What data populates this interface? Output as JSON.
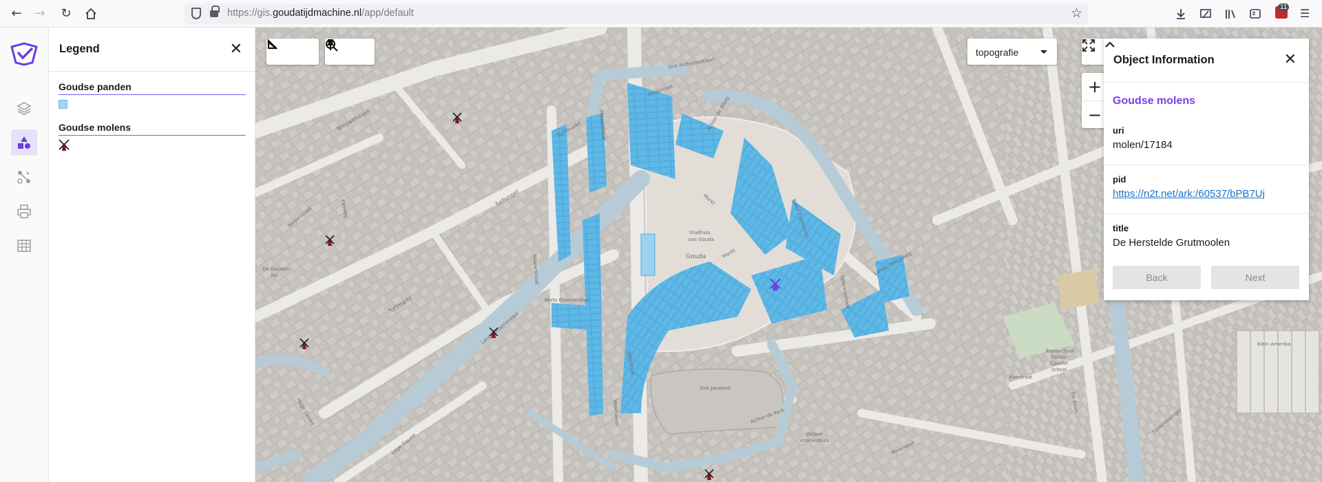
{
  "browser": {
    "url_prefix": "https://gis.",
    "url_domain": "goudatijdmachine.nl",
    "url_path": "/app/default",
    "extension_count": "11"
  },
  "rail": {
    "items": [
      {
        "name": "layers-icon",
        "active": false
      },
      {
        "name": "legend-icon",
        "active": true
      },
      {
        "name": "analysis-icon",
        "active": false
      },
      {
        "name": "print-icon",
        "active": false
      },
      {
        "name": "table-icon",
        "active": false
      }
    ]
  },
  "legend": {
    "title": "Legend",
    "layers": [
      {
        "name": "Goudse panden",
        "symbol": "blue-square",
        "color": "#9fd6f3"
      },
      {
        "name": "Goudse molens",
        "symbol": "windmill-icon"
      }
    ]
  },
  "map": {
    "basemap": "topografie",
    "colors": {
      "panden_fill": "#5fb8e6",
      "water": "#b7cbd6",
      "buildings": "#cbc8c4",
      "ground": "#e7e3dc"
    },
    "labels": {
      "turfmarkt": "Turfmarkt",
      "turfsingel": "Turfsingel",
      "nieuwehaven": "Nieuwehaven",
      "hoogstraat": "Hoogstraat",
      "markt_1": "Markt",
      "markt_2": "Markt",
      "stadhuis_1": "Stadhuis",
      "stadhuis_2": "van Gouda",
      "gouda": "Gouda",
      "sint_janskerk": "Sint-Janskerk",
      "korte_groenendaal": "Korte Groenendaal",
      "lange_groenendaal": "Lange Groenendaal",
      "lange_tiendeweg": "Lange Tiendeweg",
      "zeugstraat": "Zeugstraat",
      "westhaven": "Westhaven",
      "achter_de_kerk": "Achter de Kerk",
      "klein_amerika": "Klein Amerika",
      "basisschool_1": "Basisschool",
      "basisschool_2": "Dalton",
      "basisschool_3": "Casimir",
      "basisschool_4": "school",
      "de_gouden_aar_1": "De Gouden",
      "de_gouden_aar_2": "Aar",
      "naaierstraat": "Naaierstraat",
      "keizerstraat": "Keizerstraat",
      "willem_1": "Willem",
      "willem_2": "Vroesenhuis",
      "kleiwegstraat": "Kleiweg",
      "wijdstraat": "Wijdstraat",
      "kerksteeg": "Kerksteeg",
      "spieringstraat": "Spieringstraat",
      "de_baan": "De Baan",
      "oosthaven": "Oosthaven",
      "fluwelensingel": "Fluwelensingel",
      "groeneweg": "Groeneweg",
      "lange_noodgodsstraat": "Lange Noodgodsstraat",
      "koestraat": "Koestraat",
      "molenwerf": "Molenwerf",
      "sint_anthoniestraat": "Sint Anthoniestraat",
      "achter_de_waag": "Achter de Waag",
      "korte_tiendeweg": "Korte Tiendeweg",
      "lage_gouwe": "Lage Gouwe",
      "hoge_gouwe": "Hoge Gouwe"
    }
  },
  "object_info": {
    "title": "Object Information",
    "layer": "Goudse molens",
    "fields": [
      {
        "key": "uri",
        "value": "molen/17184"
      },
      {
        "key": "pid",
        "value": "https://n2t.net/ark:/60537/bPB7Uj"
      },
      {
        "key": "title",
        "value": "De Herstelde Grutmoolen"
      }
    ],
    "back_label": "Back",
    "next_label": "Next"
  }
}
